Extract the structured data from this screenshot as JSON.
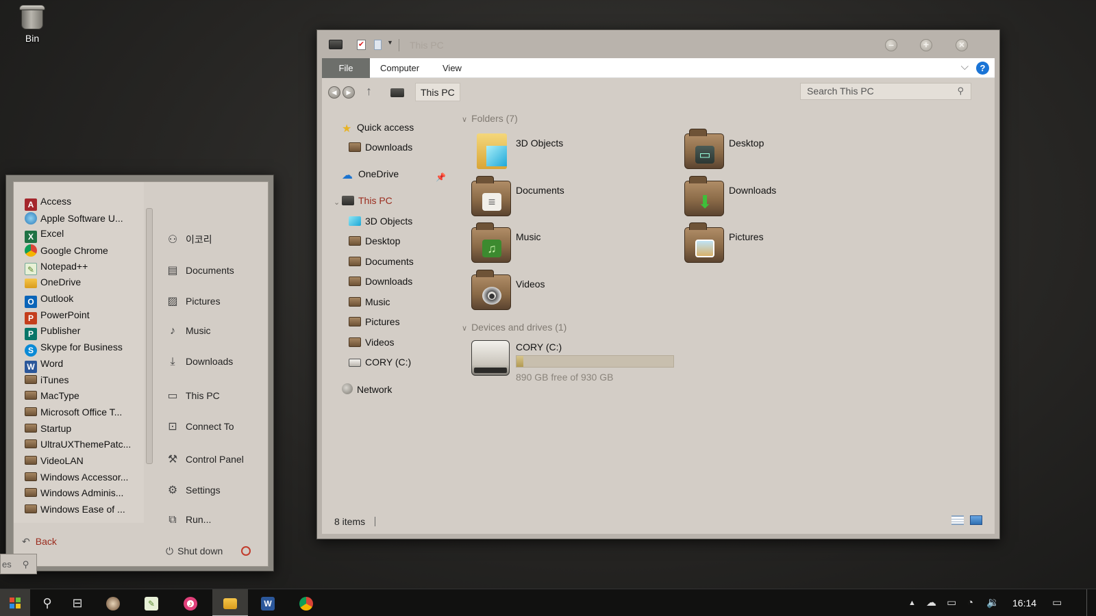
{
  "desktop": {
    "bin_label": "Bin"
  },
  "explorer": {
    "title": "This PC",
    "ribbon": {
      "tabs": [
        "File",
        "Computer",
        "View"
      ],
      "help": "?"
    },
    "address": {
      "crumb": "This PC",
      "search_placeholder": "Search This PC"
    },
    "nav": {
      "quick_access": "Quick access",
      "qa_downloads": "Downloads",
      "onedrive": "OneDrive",
      "this_pc": "This PC",
      "pc_items": [
        "3D Objects",
        "Desktop",
        "Documents",
        "Downloads",
        "Music",
        "Pictures",
        "Videos",
        "CORY (C:)"
      ],
      "network": "Network"
    },
    "folders_header": "Folders (7)",
    "folders": [
      "3D Objects",
      "Desktop",
      "Documents",
      "Downloads",
      "Music",
      "Pictures",
      "Videos"
    ],
    "devices_header": "Devices and drives (1)",
    "drive": {
      "name": "CORY (C:)",
      "free_text": "890 GB free of 930 GB",
      "used_fraction": 0.043
    },
    "status": {
      "items": "8 items"
    }
  },
  "start_menu": {
    "apps": [
      "Access",
      "Apple Software U...",
      "Excel",
      "Google Chrome",
      "Notepad++",
      "OneDrive",
      "Outlook",
      "PowerPoint",
      "Publisher",
      "Skype for Business",
      "Word",
      "iTunes",
      "MacType",
      "Microsoft Office T...",
      "Startup",
      "UltraUXThemePatc...",
      "VideoLAN",
      "Windows Accessor...",
      "Windows Adminis...",
      "Windows Ease of ..."
    ],
    "places": [
      "이코리",
      "Documents",
      "Pictures",
      "Music",
      "Downloads",
      "This PC",
      "Connect To",
      "Control Panel",
      "Settings",
      "Run..."
    ],
    "back": "Back",
    "shutdown": "Shut down",
    "search_fragment": "es"
  },
  "taskbar": {
    "clock": "16:14"
  },
  "colors": {
    "accent_selected": "#9a2b1d",
    "help_blue": "#1a74d6",
    "drive_bar": "#b29a52"
  }
}
